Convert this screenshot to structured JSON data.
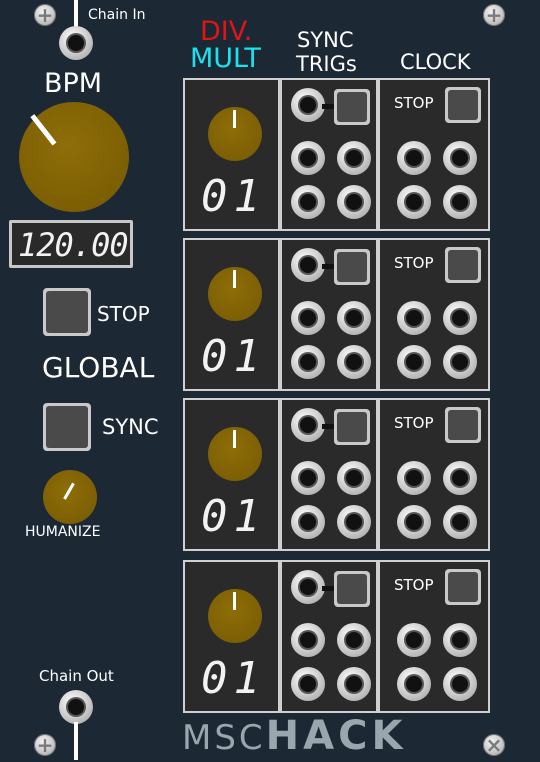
{
  "module": {
    "chain_in_label": "Chain In",
    "chain_out_label": "Chain Out",
    "bpm_label": "BPM",
    "bpm_display": "120.00",
    "stop_label": "STOP",
    "global_label": "GLOBAL",
    "sync_label": "SYNC",
    "humanize_label": "HUMANIZE",
    "brand_ms": "MSC",
    "brand_hack": "HACK"
  },
  "headers": {
    "div": "DIV.",
    "mult": "MULT",
    "sync_line1": "SYNC",
    "sync_line2": "TRIGs",
    "clock": "CLOCK"
  },
  "channels": [
    {
      "display": "01",
      "stop_label": "STOP"
    },
    {
      "display": "01",
      "stop_label": "STOP"
    },
    {
      "display": "01",
      "stop_label": "STOP"
    },
    {
      "display": "01",
      "stop_label": "STOP"
    }
  ],
  "colors": {
    "panel": "#1c2834",
    "div_red": "#e01515",
    "mult_cyan": "#19e3ef",
    "knob_gold": "#7d5f04"
  }
}
